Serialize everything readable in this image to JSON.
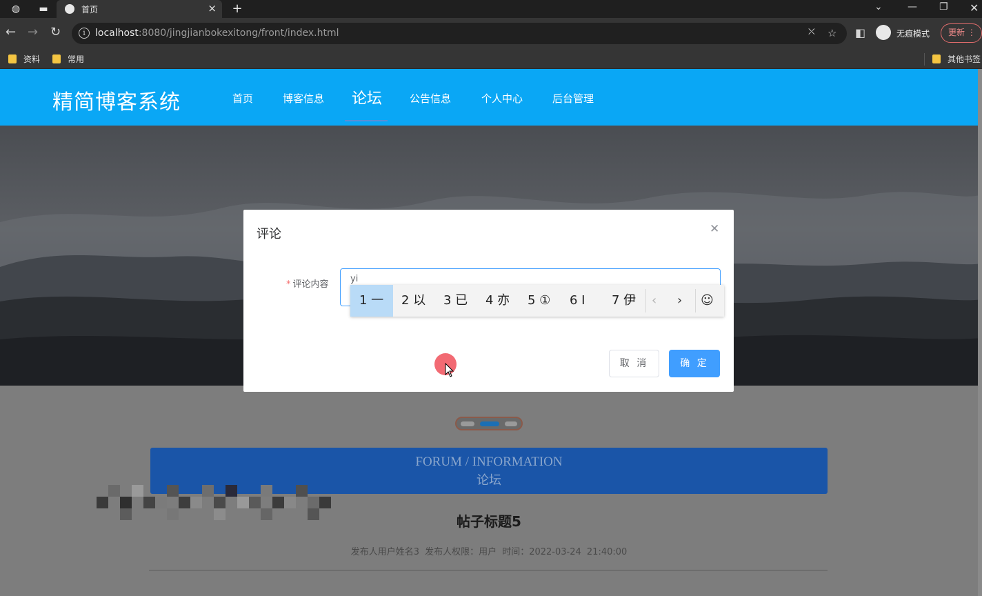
{
  "browser": {
    "tab_title": "首页",
    "url_host": "localhost",
    "url_rest": ":8080/jingjianbokexitong/front/index.html",
    "profile_label": "无痕模式",
    "update_label": "更新",
    "bookmarks": [
      "资料",
      "常用"
    ],
    "other_bookmarks": "其他书签"
  },
  "site": {
    "brand": "精简博客系统",
    "menu": [
      "首页",
      "博客信息",
      "论坛",
      "公告信息",
      "个人中心",
      "后台管理"
    ],
    "active_menu_index": 2,
    "accent_color": "#0aa7f5"
  },
  "section": {
    "title_en": "FORUM / INFORMATION",
    "title_cn": "论坛"
  },
  "post": {
    "title": "帖子标题5",
    "meta": "发布人用户姓名3  发布人权限：用户  时间：2022-03-24 21:40:00"
  },
  "dialog": {
    "title": "评论",
    "required_mark": "*",
    "field_label": "评论内容",
    "field_value": "yi",
    "cancel_label": "取 消",
    "ok_label": "确 定",
    "primary_color": "#409eff"
  },
  "ime": {
    "candidates": [
      "1 一",
      "2 以",
      "3 已",
      "4 亦",
      "5 ①",
      "6 Ⅰ",
      "7 伊"
    ],
    "selected_index": 0,
    "prev_icon": "chevron-left-icon",
    "next_icon": "chevron-right-icon",
    "emoji_icon": "smiley-icon"
  }
}
